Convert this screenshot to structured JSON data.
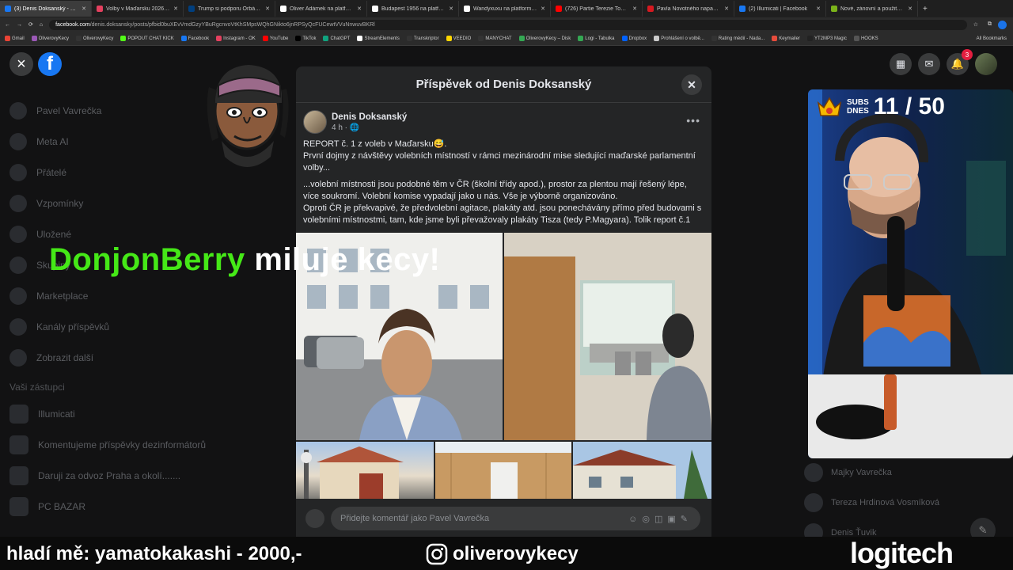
{
  "browser": {
    "tabs": [
      {
        "title": "(3) Denis Doksanský - REPORT",
        "color": "#1877f2",
        "active": true
      },
      {
        "title": "Volby v Maďarsku 2026: Sout",
        "color": "#e4405f"
      },
      {
        "title": "Trump si podporu Orbána při",
        "color": "#003f7f"
      },
      {
        "title": "Oliver Adámek na platformě X",
        "color": "#ffffff"
      },
      {
        "title": "Budapest 1956 na platformě X",
        "color": "#ffffff"
      },
      {
        "title": "Wandyxuxu na platformě X: ...",
        "color": "#ffffff"
      },
      {
        "title": "(726) Partie Terezie Tománkov",
        "color": "#ff0000"
      },
      {
        "title": "Pavla Novotného napadl Cavs",
        "color": "#d71920"
      },
      {
        "title": "(2) Illumicati | Facebook",
        "color": "#1877f2"
      },
      {
        "title": "Nové, zánovní a použité iPho",
        "color": "#7bb31a"
      }
    ],
    "url_domain": "facebook.com",
    "url_path": "/denis.doksansky/posts/pfbid0buXEvVmdGzyYBuRgcnvoVtKhSMpsWQhGNikto6jnRPSyQcFUCewtVVuNnwuvBKRl",
    "bookmarks": [
      {
        "label": "Gmail",
        "color": "#ea4335"
      },
      {
        "label": "OliverovyKecy",
        "color": "#9b59b6"
      },
      {
        "label": "OliverovyKecy",
        "color": "#333"
      },
      {
        "label": "POPOUT CHAT KICK",
        "color": "#53fc18"
      },
      {
        "label": "Facebook",
        "color": "#1877f2"
      },
      {
        "label": "Instagram - OK",
        "color": "#e4405f"
      },
      {
        "label": "YouTube",
        "color": "#ff0000"
      },
      {
        "label": "TikTok",
        "color": "#000"
      },
      {
        "label": "ChatGPT",
        "color": "#10a37f"
      },
      {
        "label": "StreamElements",
        "color": "#fff"
      },
      {
        "label": "Transkriptor",
        "color": "#333"
      },
      {
        "label": "VEEDIO",
        "color": "#ffd600"
      },
      {
        "label": "MANYCHAT",
        "color": "#333"
      },
      {
        "label": "OliverovyKecy – Disk",
        "color": "#34a853"
      },
      {
        "label": "Logi - Tabulka",
        "color": "#34a853"
      },
      {
        "label": "Dropbox",
        "color": "#0061ff"
      },
      {
        "label": "Prohlášení o volbě...",
        "color": "#ccc"
      },
      {
        "label": "Rating médií - Nada...",
        "color": "#333"
      },
      {
        "label": "Keymailer",
        "color": "#e74c3c"
      },
      {
        "label": "YT2MP3 Magic",
        "color": "#222"
      },
      {
        "label": "HOOKS",
        "color": "#555"
      }
    ],
    "all_bookmarks": "All Bookmarks"
  },
  "sidebar": {
    "items": [
      {
        "label": "Pavel Vavrečka"
      },
      {
        "label": "Meta AI"
      },
      {
        "label": "Přátelé"
      },
      {
        "label": "Vzpomínky"
      },
      {
        "label": "Uložené"
      },
      {
        "label": "Skupiny"
      },
      {
        "label": "Marketplace"
      },
      {
        "label": "Kanály příspěvků"
      },
      {
        "label": "Zobrazit další"
      }
    ],
    "section_title": "Vaši zástupci",
    "shortcuts": [
      {
        "label": "Illumicati"
      },
      {
        "label": "Komentujeme příspěvky dezinformátorů"
      },
      {
        "label": "Daruji za odvoz Praha a okolí......."
      },
      {
        "label": "PC BAZAR"
      }
    ]
  },
  "top_right": {
    "notifications_count": "3"
  },
  "contacts": [
    {
      "name": "Majky Vavrečka"
    },
    {
      "name": "Tereza Hrdinová Vosmíková"
    },
    {
      "name": "Denis Ťuvik"
    }
  ],
  "modal": {
    "title": "Příspěvek od Denis Doksanský",
    "author": "Denis Doksanský",
    "time": "4 h ·",
    "paragraphs": [
      "REPORT č. 1 z voleb v Maďarsku😅.\nPrvní dojmy z návštěvy volebních místností v rámci mezinárodní mise sledující maďarské parlamentní volby...",
      "...volební místnosti jsou podobné těm v ČR (školní třídy apod.), prostor za plentou mají řešený lépe, více soukromí. Volební komise vypadají jako u nás. Vše je výborně organizováno.\nOproti ČR je překvapivé, že předvolební agitace, plakáty atd. jsou ponechávány přímo před budovami s volebními místnostmi, tam, kde jsme byli převažovaly plakáty Tisza (tedy P.Magyara). Tolik report č.1"
    ],
    "comment_placeholder": "Přidejte komentář jako Pavel Vavrečka"
  },
  "overlays": {
    "name_highlight": "DonjonBerry",
    "name_message": "miluje kecy!",
    "subs_label_1": "SUBS",
    "subs_label_2": "DNES",
    "subs_count": "11 / 50",
    "donation_text": "hladí mě: yamatokakashi - 2000,-",
    "instagram_handle": "oliverovykecy",
    "sponsor": "logitech"
  }
}
